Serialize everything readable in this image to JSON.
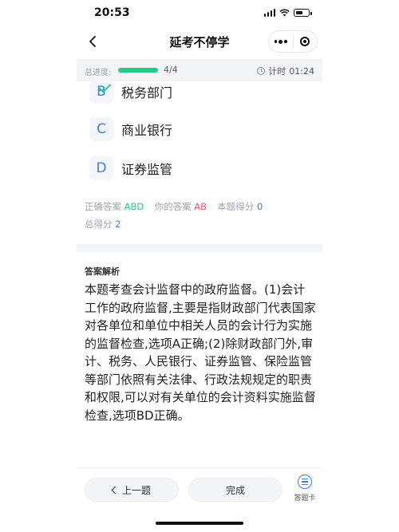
{
  "status_bar": {
    "time": "20:53"
  },
  "nav": {
    "title": "延考不停学"
  },
  "progress": {
    "label": "总进度:",
    "count": "4/4",
    "fraction": 1.0,
    "timer_label": "计时",
    "timer_value": "01:24"
  },
  "options": [
    {
      "letter": "B",
      "text": "税务部门",
      "state": "correct-selected"
    },
    {
      "letter": "C",
      "text": "商业银行",
      "state": "normal"
    },
    {
      "letter": "D",
      "text": "证券监管",
      "state": "normal"
    }
  ],
  "result": {
    "correct_label": "正确答案",
    "correct_value": "ABD",
    "yours_label": "你的答案",
    "yours_value": "AB",
    "score_label": "本题得分",
    "score_value": "0",
    "total_label": "总得分",
    "total_value": "2"
  },
  "analysis": {
    "title": "答案解析",
    "body": "本题考查会计监督中的政府监督。(1)会计工作的政府监督,主要是指财政部门代表国家对各单位和单位中相关人员的会计行为实施的监督检查,选项A正确;(2)除财政部门外,审计、税务、人民银行、证券监管、保险监管等部门依照有关法律、行政法规规定的职责和权限,可以对有关单位的会计资料实施监督检查,选项BD正确。"
  },
  "bottom": {
    "prev_label": "上一题",
    "finish_label": "完成",
    "card_label": "答题卡"
  },
  "colors": {
    "accent": "#3e7bf2",
    "correct": "#22cc86",
    "wrong": "#f0566b"
  }
}
